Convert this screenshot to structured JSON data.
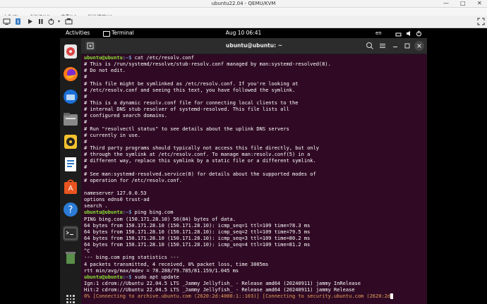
{
  "host": {
    "title": "ubuntu22.04 - QEMU/KVM",
    "menu": [
      "文件(F)",
      "虚拟机(M)",
      "查看(V)",
      "发送按键(K)"
    ]
  },
  "gnome": {
    "activities": "Activities",
    "app_name": "Terminal",
    "clock": "Aug 10  06:41",
    "input_method": "en",
    "colors": {
      "topbar": "#000000",
      "dock": "#1d1d1d"
    }
  },
  "dock_icons": [
    "disk-usage-icon",
    "firefox-icon",
    "thunderbird-icon",
    "files-icon",
    "rhythmbox-icon",
    "writer-icon",
    "app-center-icon",
    "help-icon",
    "terminal-icon",
    "trash-icon"
  ],
  "terminal": {
    "title": "ubuntu@ubuntu: ~",
    "colors": {
      "background": "#300a24",
      "user": "#8ae234",
      "path": "#729fcf"
    },
    "prompt_user": "ubuntu@ubuntu",
    "prompt_path": ":~$",
    "lines": [
      {
        "cmd": " cat /etc/resolv.conf"
      },
      {
        "text": "# This is /run/systemd/resolve/stub-resolv.conf managed by man:systemd-resolved(8)."
      },
      {
        "text": "# Do not edit."
      },
      {
        "text": "#"
      },
      {
        "text": "# This file might be symlinked as /etc/resolv.conf. If you're looking at"
      },
      {
        "text": "# /etc/resolv.conf and seeing this text, you have followed the symlink."
      },
      {
        "text": "#"
      },
      {
        "text": "# This is a dynamic resolv.conf file for connecting local clients to the"
      },
      {
        "text": "# internal DNS stub resolver of systemd-resolved. This file lists all"
      },
      {
        "text": "# configured search domains."
      },
      {
        "text": "#"
      },
      {
        "text": "# Run \"resolvectl status\" to see details about the uplink DNS servers"
      },
      {
        "text": "# currently in use."
      },
      {
        "text": "#"
      },
      {
        "text": "# Third party programs should typically not access this file directly, but only"
      },
      {
        "text": "# through the symlink at /etc/resolv.conf. To manage man:resolv.conf(5) in a"
      },
      {
        "text": "# different way, replace this symlink by a static file or a different symlink."
      },
      {
        "text": "#"
      },
      {
        "text": "# See man:systemd-resolved.service(8) for details about the supported modes of"
      },
      {
        "text": "# operation for /etc/resolv.conf."
      },
      {
        "text": ""
      },
      {
        "text": "nameserver 127.0.0.53"
      },
      {
        "text": "options edns0 trust-ad"
      },
      {
        "text": "search ."
      },
      {
        "cmd": " ping bing.com"
      },
      {
        "text": "PING bing.com (150.171.28.10) 56(84) bytes of data."
      },
      {
        "text": "64 bytes from 150.171.28.10 (150.171.28.10): icmp_seq=1 ttl=109 time=78.3 ms"
      },
      {
        "text": "64 bytes from 150.171.28.10 (150.171.28.10): icmp_seq=2 ttl=109 time=79.5 ms"
      },
      {
        "text": "64 bytes from 150.171.28.10 (150.171.28.10): icmp_seq=3 ttl=109 time=80.2 ms"
      },
      {
        "text": "64 bytes from 150.171.28.10 (150.171.28.10): icmp_seq=4 ttl=109 time=81.2 ms"
      },
      {
        "text": "^C"
      },
      {
        "text": "--- bing.com ping statistics ---"
      },
      {
        "text": "4 packets transmitted, 4 received, 0% packet loss, time 3005ms"
      },
      {
        "text": "rtt min/avg/max/mdev = 78.288/79.785/81.159/1.045 ms"
      },
      {
        "cmd": " sudo apt update"
      },
      {
        "text": "Ign:1 cdrom://Ubuntu 22.04.5 LTS _Jammy Jellyfish_ - Release amd64 (20240911) jammy InRelease"
      },
      {
        "text": "Hit:2 cdrom://Ubuntu 22.04.5 LTS _Jammy Jellyfish_ - Release amd64 (20240911) jammy Release"
      },
      {
        "progress": "0% [Connecting to archive.ubuntu.com (2620:2d:4000:1::103)] [Connecting to security.ubuntu.com (2620:2d"
      }
    ]
  }
}
